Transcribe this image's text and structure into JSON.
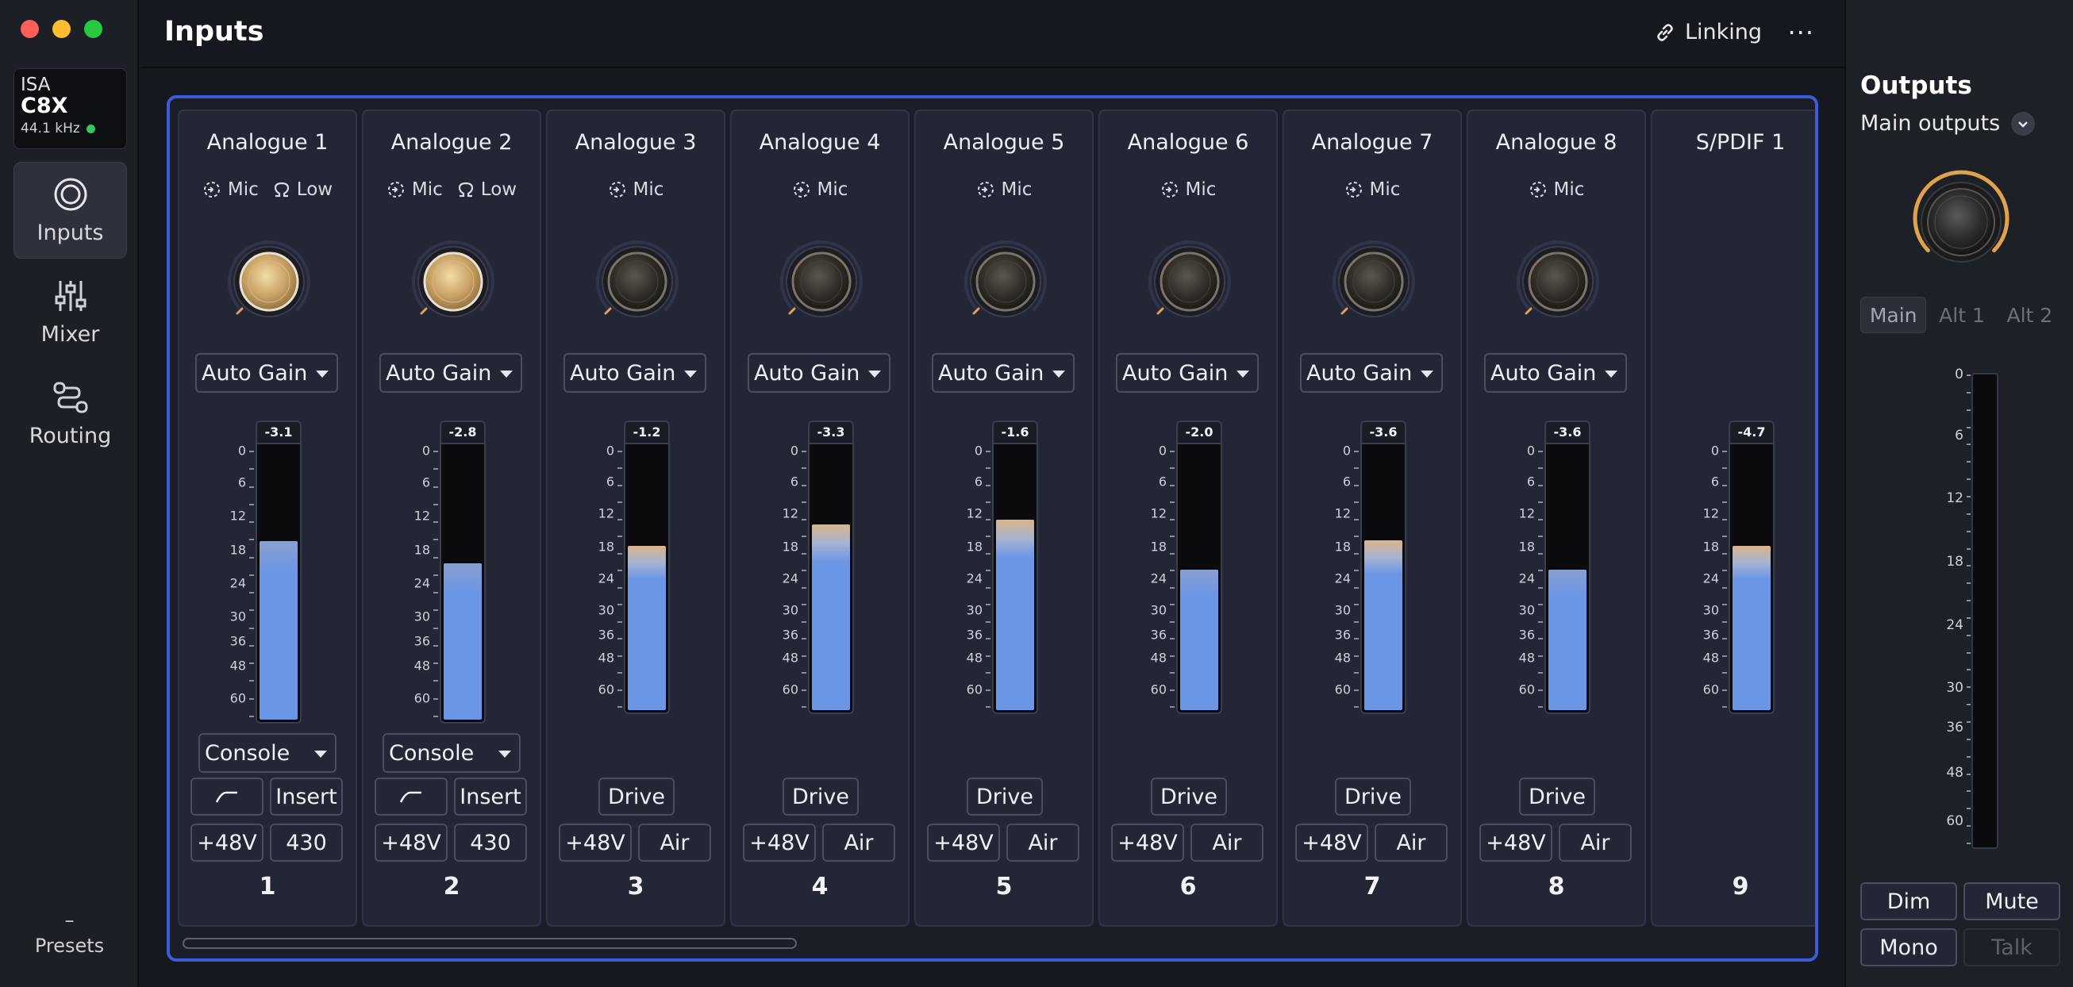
{
  "sidebar": {
    "device": {
      "brand": "ISA",
      "model": "C8X",
      "sample_rate": "44.1 kHz"
    },
    "nav": [
      {
        "label": "Inputs",
        "icon": "inputs-icon",
        "active": true
      },
      {
        "label": "Mixer",
        "icon": "mixer-icon",
        "active": false
      },
      {
        "label": "Routing",
        "icon": "routing-icon",
        "active": false
      }
    ],
    "presets_label": "Presets",
    "presets_dash": "–"
  },
  "header": {
    "title": "Inputs",
    "linking_label": "Linking",
    "more_label": "···"
  },
  "scale_labels": [
    "0",
    "6",
    "12",
    "18",
    "24",
    "30",
    "36",
    "48",
    "60"
  ],
  "channels": [
    {
      "name": "Analogue 1",
      "mic": "Mic",
      "low": "Low",
      "gain": "Auto Gain",
      "peak": "-3.1",
      "level": 0.65,
      "gold": true,
      "mode": "Console",
      "filter": true,
      "insert": "Insert",
      "phantom": "+48V",
      "extra": "430",
      "number": "1"
    },
    {
      "name": "Analogue 2",
      "mic": "Mic",
      "low": "Low",
      "gain": "Auto Gain",
      "peak": "-2.8",
      "level": 0.57,
      "gold": true,
      "mode": "Console",
      "filter": true,
      "insert": "Insert",
      "phantom": "+48V",
      "extra": "430",
      "number": "2"
    },
    {
      "name": "Analogue 3",
      "mic": "Mic",
      "gain": "Auto Gain",
      "peak": "-1.2",
      "level": 0.62,
      "drive": "Drive",
      "phantom": "+48V",
      "extra": "Air",
      "number": "3"
    },
    {
      "name": "Analogue 4",
      "mic": "Mic",
      "gain": "Auto Gain",
      "peak": "-3.3",
      "level": 0.7,
      "drive": "Drive",
      "phantom": "+48V",
      "extra": "Air",
      "number": "4"
    },
    {
      "name": "Analogue 5",
      "mic": "Mic",
      "gain": "Auto Gain",
      "peak": "-1.6",
      "level": 0.72,
      "drive": "Drive",
      "phantom": "+48V",
      "extra": "Air",
      "number": "5"
    },
    {
      "name": "Analogue 6",
      "mic": "Mic",
      "gain": "Auto Gain",
      "peak": "-2.0",
      "level": 0.53,
      "drive": "Drive",
      "phantom": "+48V",
      "extra": "Air",
      "number": "6"
    },
    {
      "name": "Analogue 7",
      "mic": "Mic",
      "gain": "Auto Gain",
      "peak": "-3.6",
      "level": 0.64,
      "drive": "Drive",
      "phantom": "+48V",
      "extra": "Air",
      "number": "7"
    },
    {
      "name": "Analogue 8",
      "mic": "Mic",
      "gain": "Auto Gain",
      "peak": "-3.6",
      "level": 0.53,
      "drive": "Drive",
      "phantom": "+48V",
      "extra": "Air",
      "number": "8"
    },
    {
      "name": "S/PDIF 1",
      "peak": "-4.7",
      "level": 0.62,
      "number": "9"
    }
  ],
  "outputs": {
    "title": "Outputs",
    "selector": "Main outputs",
    "tabs": [
      "Main",
      "Alt 1",
      "Alt 2"
    ],
    "scale_labels": [
      "0",
      "6",
      "12",
      "18",
      "24",
      "30",
      "36",
      "48",
      "60"
    ],
    "dim": "Dim",
    "mute": "Mute",
    "mono": "Mono",
    "talk": "Talk"
  },
  "colors": {
    "accent": "#3d5bd6",
    "meter_blue": "#6b96e6",
    "meter_gold": "#d9b07a",
    "gold_knob": "#d9b46b"
  }
}
